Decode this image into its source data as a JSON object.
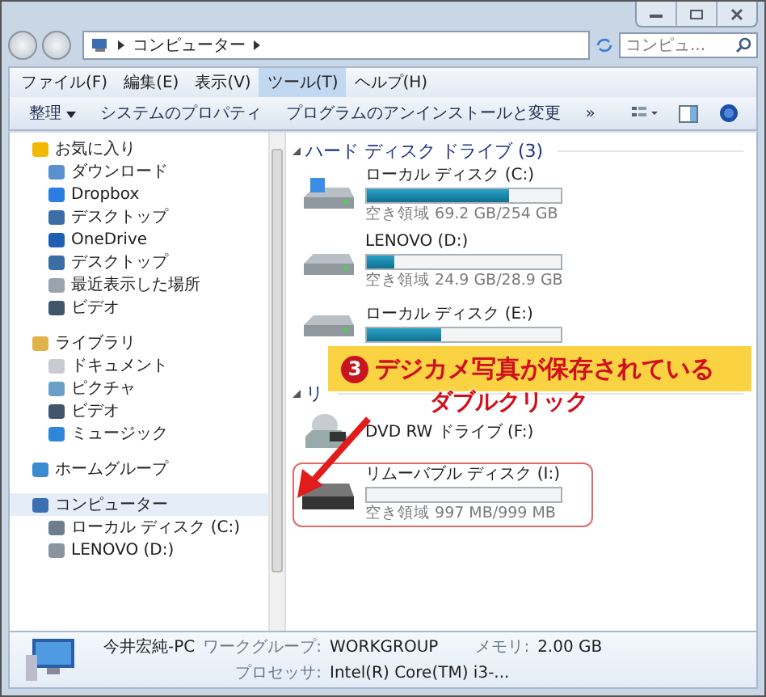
{
  "address_bar": {
    "path": [
      "コンピューター"
    ],
    "search_placeholder": "コンピュ..."
  },
  "menu": [
    {
      "label": "ファイル(F)",
      "selected": false
    },
    {
      "label": "編集(E)",
      "selected": false
    },
    {
      "label": "表示(V)",
      "selected": false
    },
    {
      "label": "ツール(T)",
      "selected": true
    },
    {
      "label": "ヘルプ(H)",
      "selected": false
    }
  ],
  "toolbar": {
    "organize": "整理",
    "buttons": [
      "システムのプロパティ",
      "プログラムのアンインストールと変更"
    ],
    "more": "»"
  },
  "sidebar": {
    "groups": [
      {
        "label": "お気に入り",
        "kind": "star",
        "selected": false,
        "children": [
          {
            "label": "ダウンロード",
            "kind": "download",
            "selected": false
          },
          {
            "label": "Dropbox",
            "kind": "dropbox",
            "selected": false
          },
          {
            "label": "デスクトップ",
            "kind": "desktop",
            "selected": false
          },
          {
            "label": "OneDrive",
            "kind": "cloud",
            "selected": false
          },
          {
            "label": "デスクトップ",
            "kind": "desktop",
            "selected": false
          },
          {
            "label": "最近表示した場所",
            "kind": "recent",
            "selected": false
          },
          {
            "label": "ビデオ",
            "kind": "video",
            "selected": false
          }
        ]
      },
      {
        "label": "ライブラリ",
        "kind": "library",
        "selected": false,
        "children": [
          {
            "label": "ドキュメント",
            "kind": "document",
            "selected": false
          },
          {
            "label": "ピクチャ",
            "kind": "picture",
            "selected": false
          },
          {
            "label": "ビデオ",
            "kind": "video",
            "selected": false
          },
          {
            "label": "ミュージック",
            "kind": "music",
            "selected": false
          }
        ]
      },
      {
        "label": "ホームグループ",
        "kind": "homegroup",
        "selected": false
      },
      {
        "label": "コンピューター",
        "kind": "computer",
        "selected": true,
        "children": [
          {
            "label": "ローカル ディスク (C:)",
            "kind": "osdisk",
            "selected": false
          },
          {
            "label": "LENOVO (D:)",
            "kind": "disk",
            "selected": false
          }
        ]
      }
    ]
  },
  "sections": [
    {
      "title": "ハード ディスク ドライブ (3)",
      "drives": [
        {
          "name": "ローカル ディスク (C:)",
          "kind": "osdisk",
          "level": 0.73,
          "free": "空き領域 69.2 GB/254 GB",
          "selected": false
        },
        {
          "name": "LENOVO (D:)",
          "kind": "disk",
          "level": 0.14,
          "free": "空き領域 24.9 GB/28.9 GB",
          "selected": false
        },
        {
          "name": "ローカル ディスク (E:)",
          "kind": "disk",
          "level": 0.38,
          "selected": false
        }
      ]
    },
    {
      "title": "リ",
      "drives": [
        {
          "name": "DVD RW ドライブ (F:)",
          "kind": "dvd",
          "selected": false
        },
        {
          "name": "リムーバブル ディスク (I:)",
          "kind": "removable",
          "level": 0.0,
          "free": "空き領域 997 MB/999 MB",
          "selected": true
        }
      ]
    }
  ],
  "details": {
    "pc_name": "今井宏純-PC",
    "fields": [
      {
        "label": "ワークグループ:",
        "value": "WORKGROUP"
      },
      {
        "label": "メモリ:",
        "value": "2.00 GB"
      },
      {
        "label": "プロセッサ:",
        "value": "Intel(R) Core(TM) i3-..."
      }
    ]
  },
  "annotation": {
    "step": "3",
    "caption": "デジカメ写真が保存されている",
    "action": "ダブルクリック"
  }
}
